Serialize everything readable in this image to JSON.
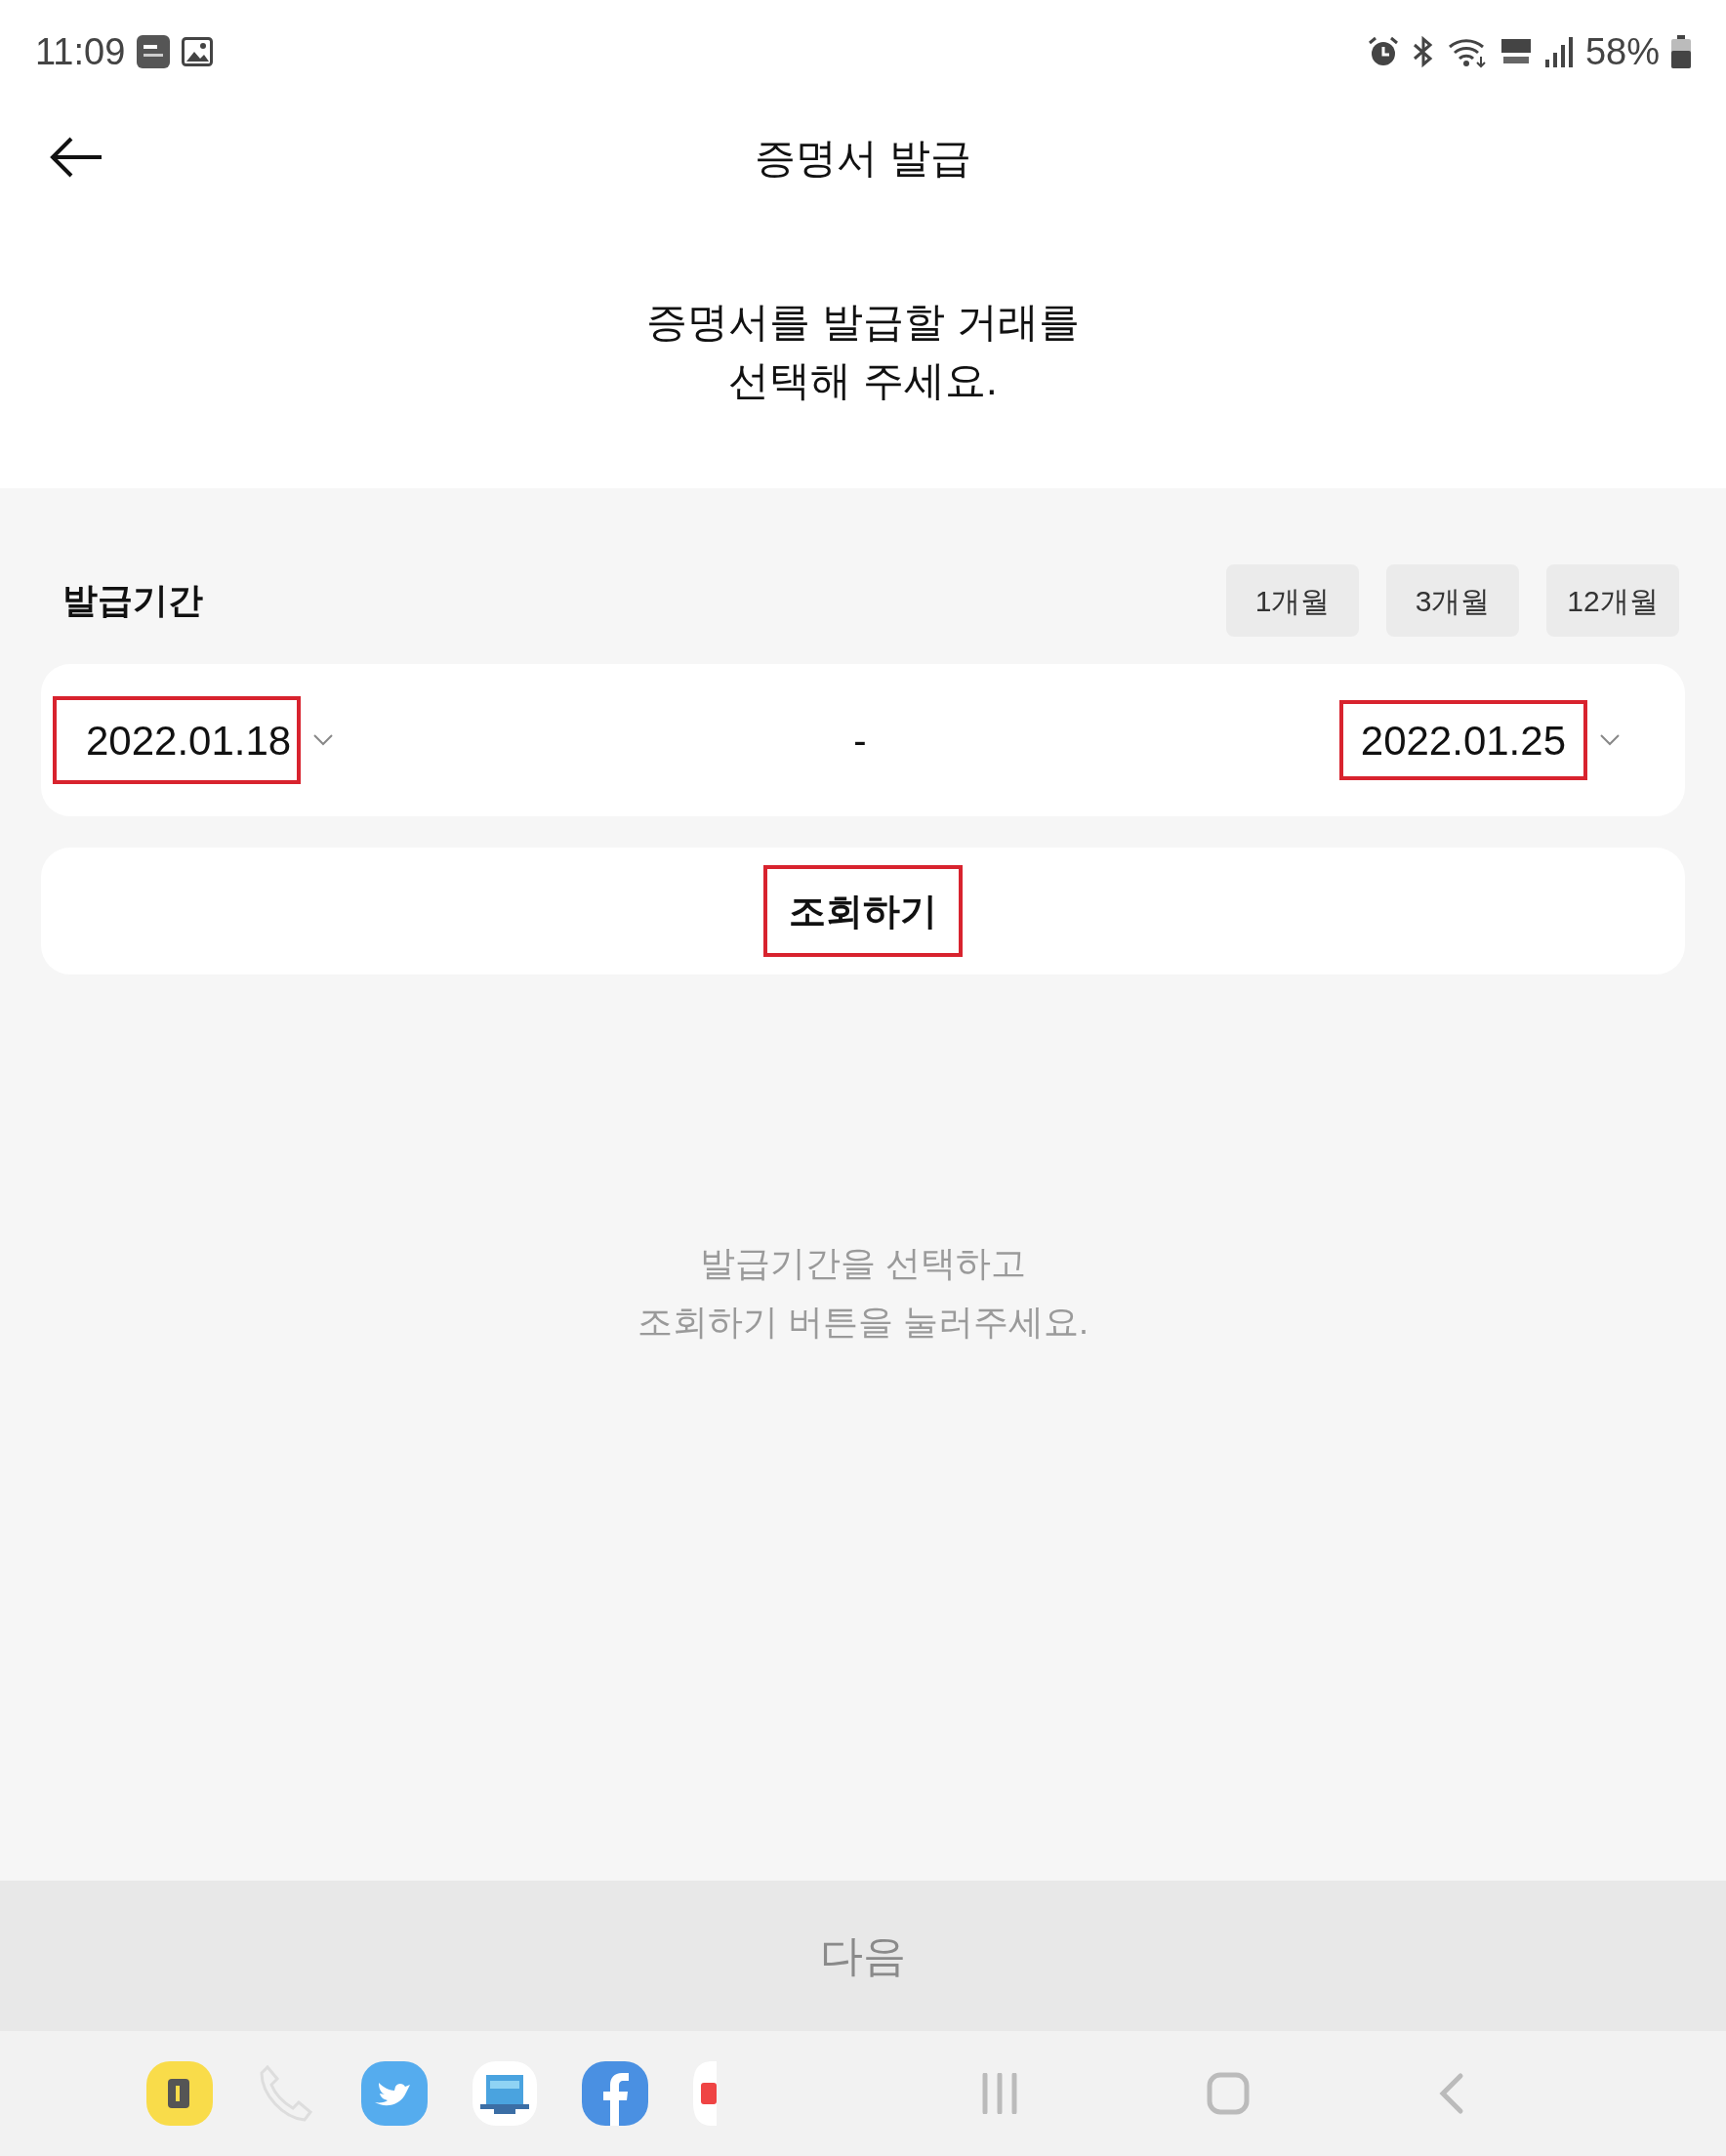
{
  "status_bar": {
    "time": "11:09",
    "battery": "58%"
  },
  "header": {
    "title": "증명서 발급"
  },
  "intro": {
    "lines": [
      "증명서를 발급할 거래를",
      "선택해 주세요."
    ]
  },
  "period": {
    "label": "발급기간",
    "chips": [
      {
        "label": "1개월",
        "selected": false
      },
      {
        "label": "3개월",
        "selected": false
      },
      {
        "label": "12개월",
        "selected": false
      }
    ],
    "start_date": "2022.01.18",
    "separator": "-",
    "end_date": "2022.01.25"
  },
  "search_button": "조회하기",
  "empty_message": [
    "발급기간을 선택하고",
    "조회하기 버튼을 눌러주세요."
  ],
  "next_button": {
    "label": "다음",
    "disabled": true
  }
}
